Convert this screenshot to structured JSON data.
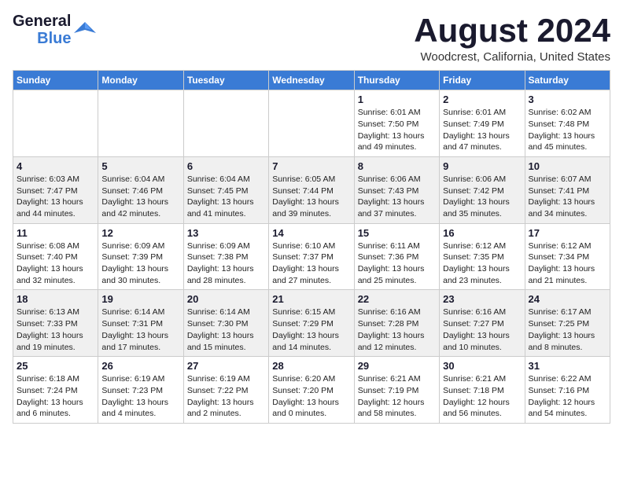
{
  "header": {
    "logo_line1": "General",
    "logo_line2": "Blue",
    "month_title": "August 2024",
    "location": "Woodcrest, California, United States"
  },
  "weekdays": [
    "Sunday",
    "Monday",
    "Tuesday",
    "Wednesday",
    "Thursday",
    "Friday",
    "Saturday"
  ],
  "weeks": [
    [
      {
        "day": "",
        "info": ""
      },
      {
        "day": "",
        "info": ""
      },
      {
        "day": "",
        "info": ""
      },
      {
        "day": "",
        "info": ""
      },
      {
        "day": "1",
        "info": "Sunrise: 6:01 AM\nSunset: 7:50 PM\nDaylight: 13 hours\nand 49 minutes."
      },
      {
        "day": "2",
        "info": "Sunrise: 6:01 AM\nSunset: 7:49 PM\nDaylight: 13 hours\nand 47 minutes."
      },
      {
        "day": "3",
        "info": "Sunrise: 6:02 AM\nSunset: 7:48 PM\nDaylight: 13 hours\nand 45 minutes."
      }
    ],
    [
      {
        "day": "4",
        "info": "Sunrise: 6:03 AM\nSunset: 7:47 PM\nDaylight: 13 hours\nand 44 minutes."
      },
      {
        "day": "5",
        "info": "Sunrise: 6:04 AM\nSunset: 7:46 PM\nDaylight: 13 hours\nand 42 minutes."
      },
      {
        "day": "6",
        "info": "Sunrise: 6:04 AM\nSunset: 7:45 PM\nDaylight: 13 hours\nand 41 minutes."
      },
      {
        "day": "7",
        "info": "Sunrise: 6:05 AM\nSunset: 7:44 PM\nDaylight: 13 hours\nand 39 minutes."
      },
      {
        "day": "8",
        "info": "Sunrise: 6:06 AM\nSunset: 7:43 PM\nDaylight: 13 hours\nand 37 minutes."
      },
      {
        "day": "9",
        "info": "Sunrise: 6:06 AM\nSunset: 7:42 PM\nDaylight: 13 hours\nand 35 minutes."
      },
      {
        "day": "10",
        "info": "Sunrise: 6:07 AM\nSunset: 7:41 PM\nDaylight: 13 hours\nand 34 minutes."
      }
    ],
    [
      {
        "day": "11",
        "info": "Sunrise: 6:08 AM\nSunset: 7:40 PM\nDaylight: 13 hours\nand 32 minutes."
      },
      {
        "day": "12",
        "info": "Sunrise: 6:09 AM\nSunset: 7:39 PM\nDaylight: 13 hours\nand 30 minutes."
      },
      {
        "day": "13",
        "info": "Sunrise: 6:09 AM\nSunset: 7:38 PM\nDaylight: 13 hours\nand 28 minutes."
      },
      {
        "day": "14",
        "info": "Sunrise: 6:10 AM\nSunset: 7:37 PM\nDaylight: 13 hours\nand 27 minutes."
      },
      {
        "day": "15",
        "info": "Sunrise: 6:11 AM\nSunset: 7:36 PM\nDaylight: 13 hours\nand 25 minutes."
      },
      {
        "day": "16",
        "info": "Sunrise: 6:12 AM\nSunset: 7:35 PM\nDaylight: 13 hours\nand 23 minutes."
      },
      {
        "day": "17",
        "info": "Sunrise: 6:12 AM\nSunset: 7:34 PM\nDaylight: 13 hours\nand 21 minutes."
      }
    ],
    [
      {
        "day": "18",
        "info": "Sunrise: 6:13 AM\nSunset: 7:33 PM\nDaylight: 13 hours\nand 19 minutes."
      },
      {
        "day": "19",
        "info": "Sunrise: 6:14 AM\nSunset: 7:31 PM\nDaylight: 13 hours\nand 17 minutes."
      },
      {
        "day": "20",
        "info": "Sunrise: 6:14 AM\nSunset: 7:30 PM\nDaylight: 13 hours\nand 15 minutes."
      },
      {
        "day": "21",
        "info": "Sunrise: 6:15 AM\nSunset: 7:29 PM\nDaylight: 13 hours\nand 14 minutes."
      },
      {
        "day": "22",
        "info": "Sunrise: 6:16 AM\nSunset: 7:28 PM\nDaylight: 13 hours\nand 12 minutes."
      },
      {
        "day": "23",
        "info": "Sunrise: 6:16 AM\nSunset: 7:27 PM\nDaylight: 13 hours\nand 10 minutes."
      },
      {
        "day": "24",
        "info": "Sunrise: 6:17 AM\nSunset: 7:25 PM\nDaylight: 13 hours\nand 8 minutes."
      }
    ],
    [
      {
        "day": "25",
        "info": "Sunrise: 6:18 AM\nSunset: 7:24 PM\nDaylight: 13 hours\nand 6 minutes."
      },
      {
        "day": "26",
        "info": "Sunrise: 6:19 AM\nSunset: 7:23 PM\nDaylight: 13 hours\nand 4 minutes."
      },
      {
        "day": "27",
        "info": "Sunrise: 6:19 AM\nSunset: 7:22 PM\nDaylight: 13 hours\nand 2 minutes."
      },
      {
        "day": "28",
        "info": "Sunrise: 6:20 AM\nSunset: 7:20 PM\nDaylight: 13 hours\nand 0 minutes."
      },
      {
        "day": "29",
        "info": "Sunrise: 6:21 AM\nSunset: 7:19 PM\nDaylight: 12 hours\nand 58 minutes."
      },
      {
        "day": "30",
        "info": "Sunrise: 6:21 AM\nSunset: 7:18 PM\nDaylight: 12 hours\nand 56 minutes."
      },
      {
        "day": "31",
        "info": "Sunrise: 6:22 AM\nSunset: 7:16 PM\nDaylight: 12 hours\nand 54 minutes."
      }
    ]
  ]
}
